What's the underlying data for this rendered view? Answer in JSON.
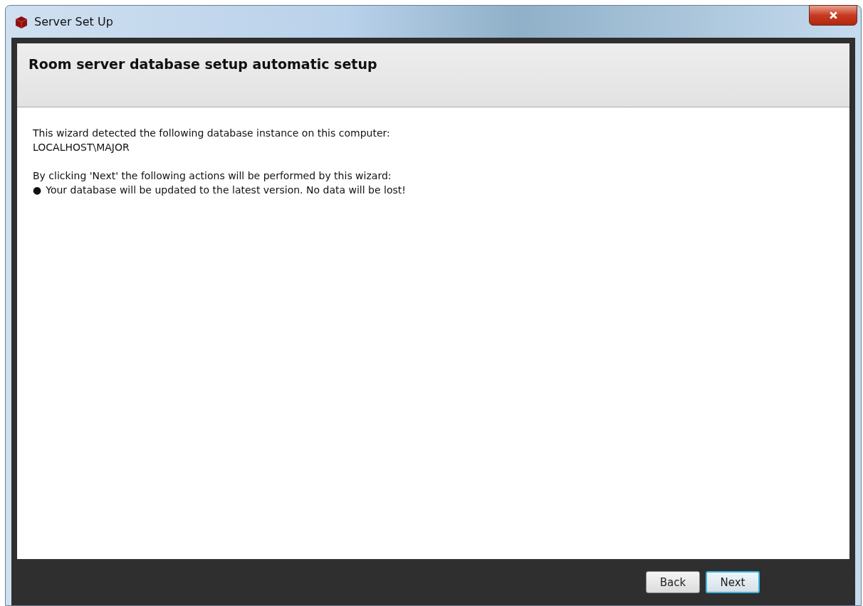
{
  "window": {
    "title": "Server Set Up"
  },
  "header": {
    "title": "Room server database setup automatic setup"
  },
  "content": {
    "lines": [
      {
        "kind": "text",
        "text": "This wizard detected the following database instance on this computer:"
      },
      {
        "kind": "text",
        "text": "LOCALHOST\\MAJOR"
      },
      {
        "kind": "gap"
      },
      {
        "kind": "text",
        "text": "By clicking 'Next' the following actions will be performed by this wizard:"
      },
      {
        "kind": "bullet",
        "bullet": "●",
        "text": "Your database will be updated to the latest version. No data will be lost!"
      }
    ]
  },
  "buttons": [
    {
      "label": "Back",
      "focused": false
    },
    {
      "label": "Next",
      "focused": true
    }
  ]
}
